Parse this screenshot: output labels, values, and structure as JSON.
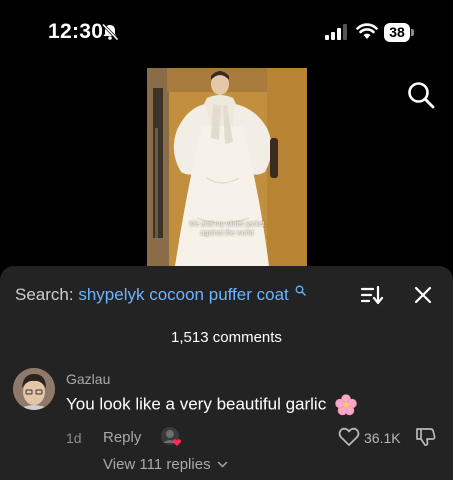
{
  "status_bar": {
    "time": "12:30",
    "battery": "38"
  },
  "video": {
    "caption_line1": "Me and my winter jacket",
    "caption_line2": "against the world"
  },
  "comments_sheet": {
    "search_prefix": "Search:",
    "search_query": "shypelyk cocoon puffer coat",
    "comment_count": "1,513 comments"
  },
  "comment": {
    "username": "Gazlau",
    "text": "You look like a very beautiful garlic",
    "age": "1d",
    "reply_label": "Reply",
    "like_count": "36.1K",
    "view_replies": "View 111 replies"
  },
  "colors": {
    "link_blue": "#6ab4ff",
    "sheet_bg": "#232323",
    "like_heart": "#ff2d55"
  }
}
